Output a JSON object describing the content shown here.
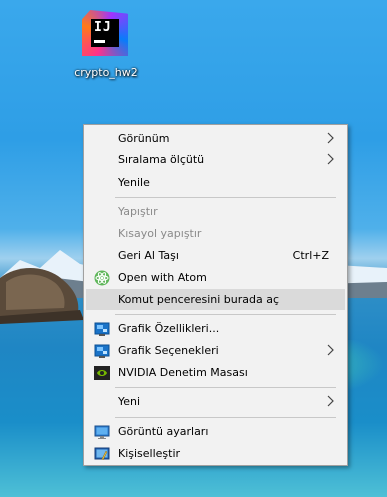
{
  "desktop": {
    "icon_label": "crypto_hw2",
    "icon_logo_text": "IJ",
    "icon_name": "intellij-idea-icon"
  },
  "context_menu": {
    "items": {
      "gorunum": "Görünüm",
      "siralama": "Sıralama ölçütü",
      "yenile": "Yenile",
      "yapistir": "Yapıştır",
      "kisayol": "Kısayol yapıştır",
      "geri_al": "Geri Al Taşı",
      "geri_al_shortcut": "Ctrl+Z",
      "atom": "Open with Atom",
      "komut": "Komut penceresini burada aç",
      "grafik_ozellik": "Grafik Özellikleri...",
      "grafik_secenek": "Grafik Seçenekleri",
      "nvidia": "NVIDIA Denetim Masası",
      "yeni": "Yeni",
      "goruntu": "Görüntü ayarları",
      "kisisel": "Kişiselleştir"
    },
    "highlighted_item": "Komut penceresini burada aç",
    "disabled_items": [
      "Yapıştır",
      "Kısayol yapıştır"
    ]
  },
  "colors": {
    "menu_bg": "#f2f2f2",
    "menu_border": "#a0a0a0",
    "hover_bg": "#dadada",
    "disabled_text": "#8a8a8a",
    "desktop_sky": "#2e9ee6"
  }
}
